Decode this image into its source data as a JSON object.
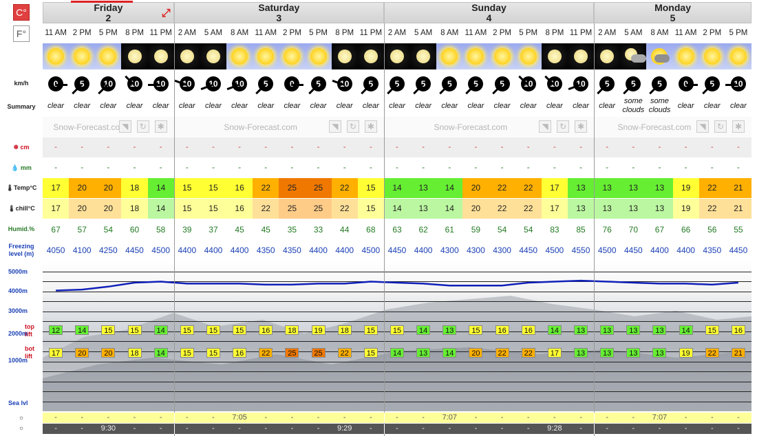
{
  "units": {
    "celsius": "C°",
    "fahrenheit": "F°"
  },
  "labels": {
    "wind": "km/h",
    "summary": "Summary",
    "snow": "cm",
    "rain": "mm",
    "temp": "Temp°C",
    "chill": "chill°C",
    "humid": "Humid.%",
    "freezing_line1": "Freezing",
    "freezing_line2": "level (m)",
    "toplift_line1": "top",
    "toplift_line2": "lift",
    "botlift_line1": "bot",
    "botlift_line2": "lift",
    "alt5000": "5000m",
    "alt4000": "4000m",
    "alt3000": "3000m",
    "alt2000": "2000m",
    "alt1000": "1000m",
    "sealvl": "Sea lvl"
  },
  "days": [
    {
      "name": "Friday",
      "date": "2"
    },
    {
      "name": "Saturday",
      "date": "3"
    },
    {
      "name": "Sunday",
      "date": "4"
    },
    {
      "name": "Monday",
      "date": "5"
    }
  ],
  "logo_text": "Snow-Forecast.com",
  "times": [
    "11 AM",
    "2 PM",
    "5 PM",
    "8 PM",
    "11 PM",
    "2 AM",
    "5 AM",
    "8 AM",
    "11 AM",
    "2 PM",
    "5 PM",
    "8 PM",
    "11 PM",
    "2 AM",
    "5 AM",
    "8 AM",
    "11 AM",
    "2 PM",
    "5 PM",
    "8 PM",
    "11 PM",
    "2 AM",
    "5 AM",
    "8 AM",
    "11 AM",
    "2 PM",
    "5 PM"
  ],
  "sky": [
    "sun",
    "sun",
    "sun",
    "moon",
    "moon",
    "moon",
    "moon",
    "sun",
    "sun",
    "sun",
    "sun",
    "moon",
    "moon",
    "moon",
    "moon",
    "sun",
    "sun",
    "sun",
    "sun",
    "moon",
    "moon",
    "moon",
    "cloud-moon",
    "cloud-sun",
    "sun",
    "sun",
    "sun"
  ],
  "wind": [
    "0",
    "5",
    "10",
    "10",
    "10",
    "10",
    "10",
    "10",
    "5",
    "0",
    "5",
    "10",
    "5",
    "5",
    "5",
    "5",
    "5",
    "5",
    "10",
    "10",
    "10",
    "5",
    "5",
    "5",
    "0",
    "5",
    "10"
  ],
  "summary": [
    "clear",
    "clear",
    "clear",
    "clear",
    "clear",
    "clear",
    "clear",
    "clear",
    "clear",
    "clear",
    "clear",
    "clear",
    "clear",
    "clear",
    "clear",
    "clear",
    "clear",
    "clear",
    "clear",
    "clear",
    "clear",
    "clear",
    "some clouds",
    "some clouds",
    "clear",
    "clear",
    "clear"
  ],
  "snow": [
    "-",
    "-",
    "-",
    "-",
    "-",
    "-",
    "-",
    "-",
    "-",
    "-",
    "-",
    "-",
    "-",
    "-",
    "-",
    "-",
    "-",
    "-",
    "-",
    "-",
    "-",
    "-",
    "-",
    "-",
    "-",
    "-",
    "-"
  ],
  "rain": [
    "-",
    "-",
    "-",
    "-",
    "-",
    "-",
    "-",
    "-",
    "-",
    "-",
    "-",
    "-",
    "-",
    "-",
    "-",
    "-",
    "-",
    "-",
    "-",
    "-",
    "-",
    "-",
    "-",
    "-",
    "-",
    "-",
    "-"
  ],
  "temp": [
    "17",
    "20",
    "20",
    "18",
    "14",
    "15",
    "15",
    "16",
    "22",
    "25",
    "25",
    "22",
    "15",
    "14",
    "13",
    "14",
    "20",
    "22",
    "22",
    "17",
    "13",
    "13",
    "13",
    "13",
    "19",
    "22",
    "21"
  ],
  "chill": [
    "17",
    "20",
    "20",
    "18",
    "14",
    "15",
    "15",
    "16",
    "22",
    "25",
    "25",
    "22",
    "15",
    "14",
    "13",
    "14",
    "20",
    "22",
    "22",
    "17",
    "13",
    "13",
    "13",
    "13",
    "19",
    "22",
    "21"
  ],
  "humid": [
    "67",
    "57",
    "54",
    "60",
    "58",
    "39",
    "37",
    "45",
    "45",
    "35",
    "33",
    "44",
    "68",
    "63",
    "62",
    "61",
    "59",
    "54",
    "54",
    "83",
    "85",
    "76",
    "70",
    "67",
    "66",
    "56",
    "55"
  ],
  "freezing": [
    "4050",
    "4100",
    "4250",
    "4450",
    "4500",
    "4400",
    "4400",
    "4400",
    "4350",
    "4350",
    "4400",
    "4400",
    "4500",
    "4450",
    "4400",
    "4300",
    "4300",
    "4300",
    "4450",
    "4500",
    "4550",
    "4500",
    "4450",
    "4400",
    "4400",
    "4350",
    "4450"
  ],
  "toplift": [
    "12",
    "14",
    "15",
    "15",
    "14",
    "15",
    "15",
    "15",
    "16",
    "18",
    "19",
    "18",
    "15",
    "15",
    "14",
    "13",
    "15",
    "16",
    "16",
    "14",
    "13",
    "13",
    "13",
    "13",
    "14",
    "15",
    "16"
  ],
  "botlift": [
    "17",
    "20",
    "20",
    "18",
    "14",
    "15",
    "15",
    "16",
    "22",
    "25",
    "25",
    "22",
    "15",
    "14",
    "13",
    "14",
    "20",
    "22",
    "22",
    "17",
    "13",
    "13",
    "13",
    "13",
    "19",
    "22",
    "21"
  ],
  "sunrise": {
    "day2": "7:05",
    "day3": "7:07",
    "day4": "7:07"
  },
  "sunset": {
    "day1": "9:30",
    "day2": "9:29",
    "day3": "9:28"
  },
  "colors": {
    "hot": "#f07800",
    "warm": "#ffb000",
    "mild": "#ffff33",
    "cool": "#66ee33",
    "sunbar": "#ffff99",
    "moonbar": "#555555"
  }
}
